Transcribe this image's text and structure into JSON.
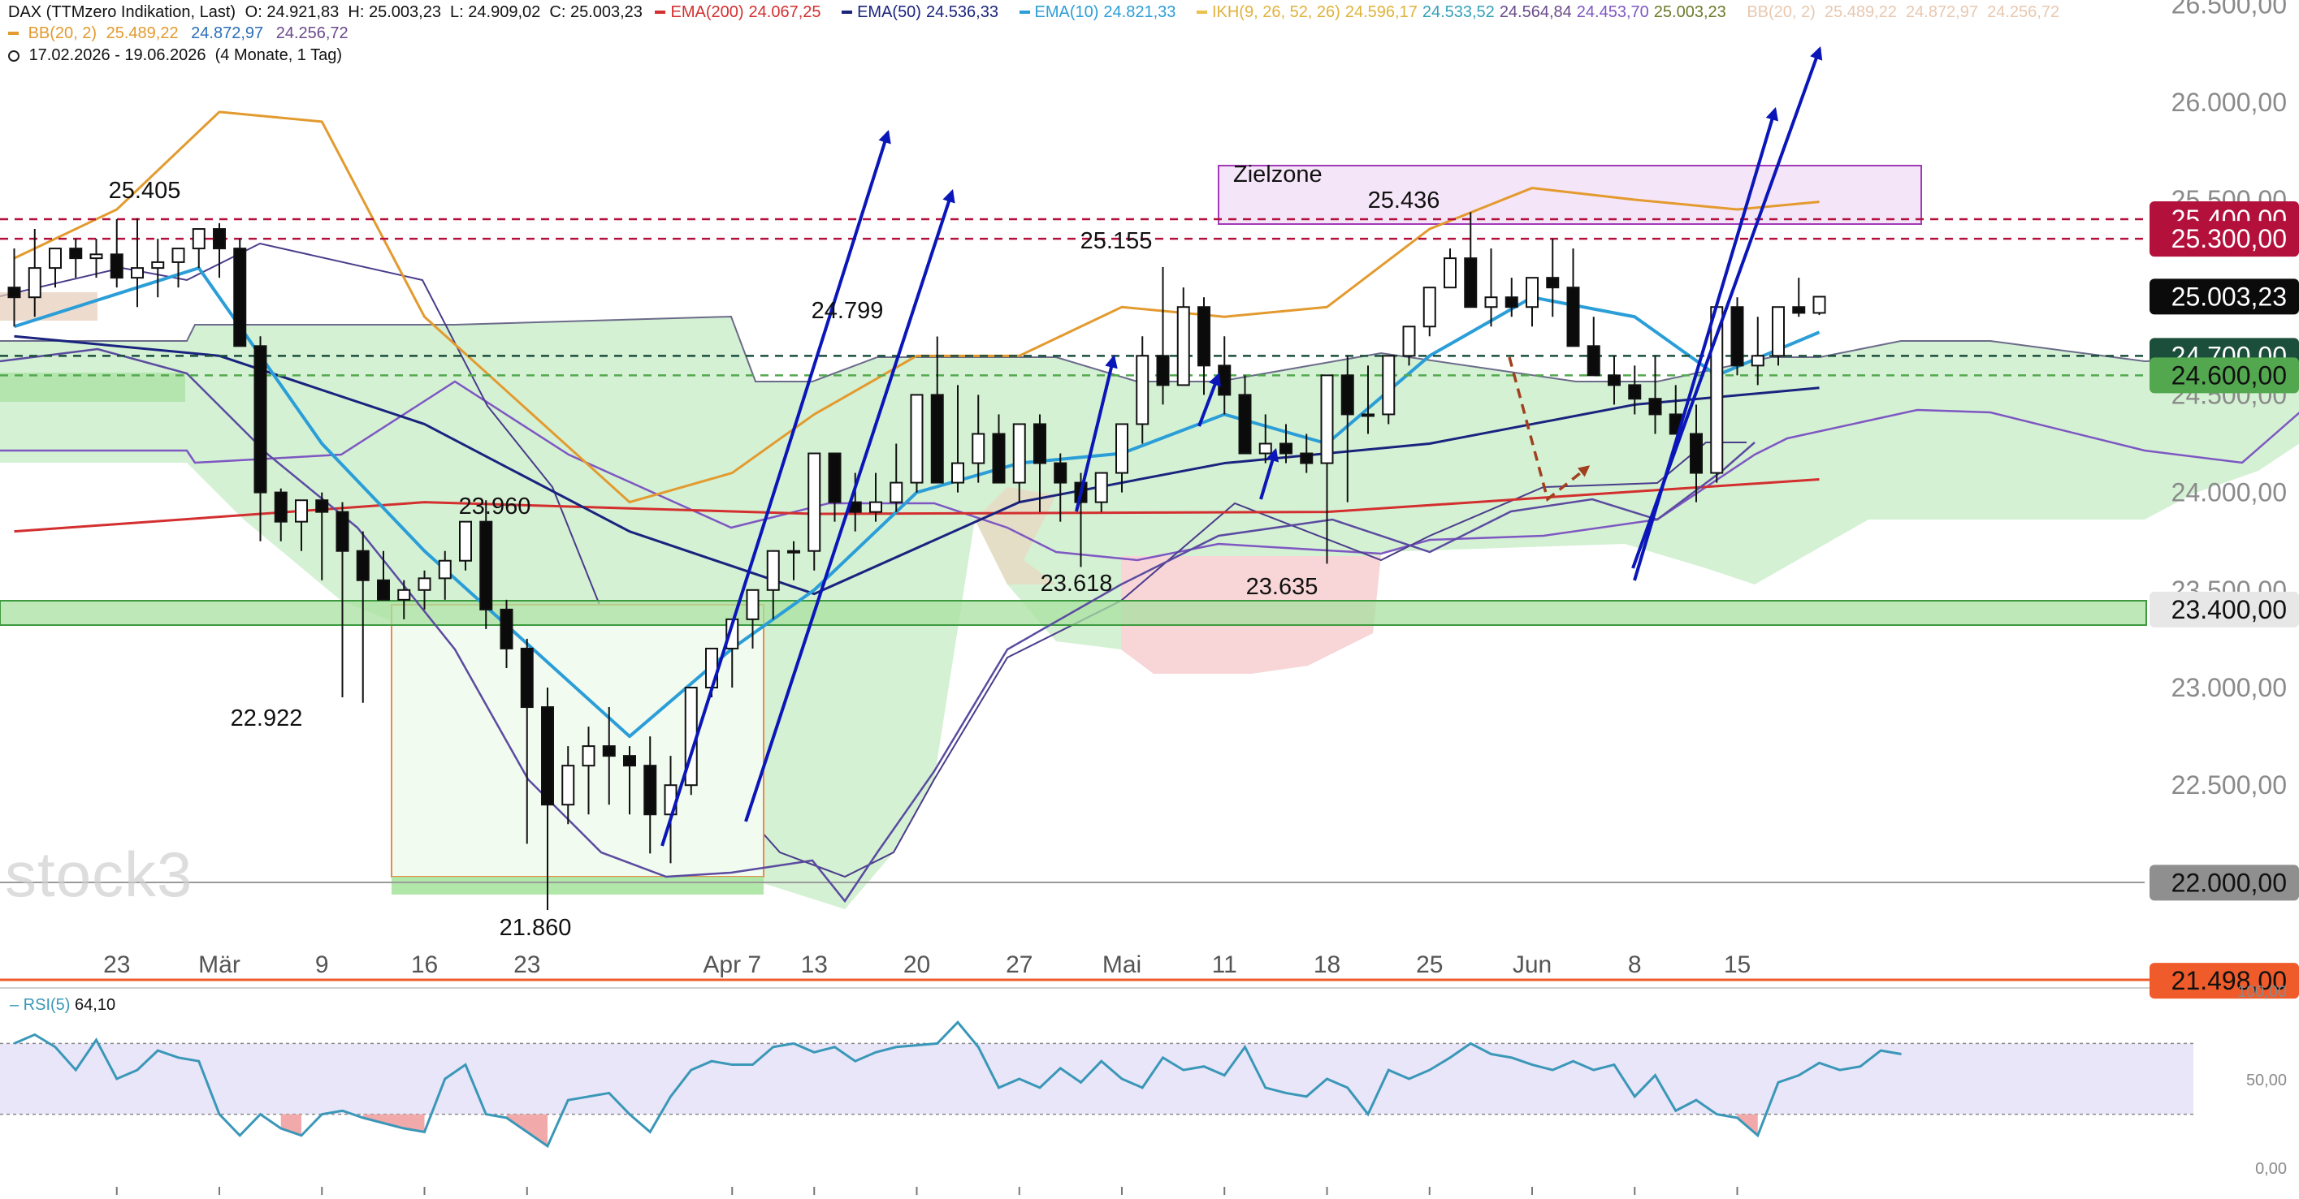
{
  "header": {
    "line1": {
      "title": "DAX (TTMzero Indikation, Last)",
      "ohlc": "O: 24.921,83  H: 25.003,23  L: 24.909,02  C: 25.003,23",
      "ema200_label": "EMA(200)",
      "ema200_value": "24.067,25",
      "ema50_label": "EMA(50)",
      "ema50_value": "24.536,33",
      "ema10_label": "EMA(10)",
      "ema10_value": "24.821,33",
      "ikh_label": "IKH(9, 26, 52, 26)",
      "ikh_v1": "24.596,17",
      "ikh_v2": "24.533,52",
      "ikh_v3": "24.564,84",
      "ikh_v4": "24.453,70",
      "ikh_v5": "25.003,23",
      "bb_faded": "BB(20, 2)  25.489,22  24.872,97  24.256,72"
    },
    "line2": {
      "bb_label": "BB(20, 2)",
      "bb_v1": "25.489,22",
      "bb_v2": "24.872,97",
      "bb_v3": "24.256,72"
    },
    "line3": {
      "range": "17.02.2026 - 19.06.2026  (4 Monate, 1 Tag)"
    }
  },
  "watermark": "stock3",
  "colors": {
    "ema200": "#d32f2f",
    "ema50": "#1a237e",
    "ema10": "#2b9ed8",
    "bb": "#e39a2e",
    "ikh_tenkan": "#e9c14c",
    "senkou_a": "#7e57c2",
    "senkou_b": "#4b3c8a",
    "kumo_up": "#cdeecc",
    "kumo_down": "#f8d6d8",
    "arrow": "#0a16b8",
    "last_price_bg": "#0b0b0b",
    "red_level": "#b3103c",
    "green_level": "#53a84f"
  },
  "chart_data": [
    {
      "type": "candlestick",
      "title": "",
      "x": [
        "16.02",
        "17.02",
        "18.02",
        "19.02",
        "20.02",
        "23.02",
        "24.02",
        "25.02",
        "26.02",
        "27.02",
        "02.03",
        "03.03",
        "04.03",
        "05.03",
        "06.03",
        "09.03",
        "10.03",
        "11.03",
        "12.03",
        "13.03",
        "16.03",
        "17.03",
        "18.03",
        "19.03",
        "20.03",
        "23.03",
        "24.03",
        "25.03",
        "26.03",
        "27.03",
        "30.03",
        "31.03",
        "01.04",
        "02.04",
        "03.04",
        "07.04",
        "08.04",
        "09.04",
        "10.04",
        "13.04",
        "14.04",
        "15.04",
        "16.04",
        "17.04",
        "20.04",
        "21.04",
        "22.04",
        "23.04",
        "24.04",
        "27.04",
        "28.04",
        "29.04",
        "30.04",
        "01.05",
        "04.05",
        "05.05",
        "06.05",
        "07.05",
        "08.05",
        "11.05",
        "12.05",
        "13.05",
        "14.05",
        "15.05",
        "18.05",
        "19.05",
        "20.05",
        "21.05",
        "22.05",
        "25.05",
        "26.05",
        "27.05",
        "28.05",
        "29.05",
        "01.06",
        "02.06",
        "03.06",
        "04.06",
        "05.06",
        "08.06",
        "09.06",
        "10.06",
        "11.06",
        "12.06",
        "15.06",
        "16.06",
        "17.06",
        "18.06",
        "19.06"
      ],
      "open": [
        25050,
        25000,
        25150,
        25250,
        25200,
        25220,
        25100,
        25150,
        25180,
        25250,
        25350,
        25250,
        24750,
        24000,
        23850,
        23960,
        23900,
        23700,
        23550,
        23450,
        23500,
        23560,
        23650,
        23850,
        23400,
        23200,
        22900,
        22400,
        22600,
        22700,
        22650,
        22600,
        22350,
        22500,
        23000,
        23200,
        23350,
        23500,
        23700,
        23700,
        24200,
        23950,
        23900,
        23950,
        24050,
        24500,
        24050,
        24150,
        24300,
        24050,
        24350,
        24150,
        24050,
        23950,
        24100,
        24350,
        24700,
        24550,
        24950,
        24650,
        24500,
        24200,
        24250,
        24200,
        24150,
        24600,
        24400,
        24400,
        24700,
        24850,
        25050,
        25200,
        24950,
        25000,
        24950,
        25100,
        25050,
        24750,
        24600,
        24550,
        24480,
        24400,
        24300,
        24100,
        24950,
        24650,
        24700,
        24950,
        24920
      ],
      "high": [
        25250,
        25350,
        25200,
        25300,
        25300,
        25400,
        25405,
        25300,
        25250,
        25300,
        25380,
        25300,
        24800,
        24020,
        23960,
        24000,
        23950,
        23800,
        23700,
        23550,
        23600,
        23700,
        23850,
        23960,
        23450,
        23250,
        23000,
        22700,
        22800,
        22900,
        22700,
        22750,
        22650,
        22950,
        23200,
        23350,
        23500,
        23600,
        23750,
        23850,
        24200,
        24100,
        24100,
        24250,
        24400,
        24799,
        24550,
        24500,
        24400,
        24300,
        24400,
        24200,
        24100,
        24050,
        24300,
        24800,
        25155,
        25050,
        25000,
        24800,
        24600,
        24400,
        24350,
        24300,
        24300,
        24700,
        24650,
        24700,
        24850,
        25050,
        25250,
        25436,
        25250,
        25100,
        25100,
        25300,
        25250,
        24900,
        24700,
        24650,
        24700,
        24550,
        24450,
        24600,
        25000,
        24900,
        24900,
        25100,
        25003
      ],
      "low": [
        24850,
        24900,
        25050,
        25100,
        25100,
        25050,
        24950,
        25000,
        25050,
        25150,
        25100,
        24800,
        23750,
        23750,
        23700,
        23550,
        22950,
        22922,
        23450,
        23350,
        23400,
        23450,
        23600,
        23300,
        23100,
        22200,
        21860,
        22300,
        22350,
        22400,
        22350,
        22150,
        22100,
        22450,
        22950,
        23000,
        23200,
        23350,
        23550,
        23600,
        23850,
        23800,
        23850,
        23900,
        24000,
        24050,
        24000,
        24050,
        24050,
        23950,
        23900,
        23850,
        23618,
        23900,
        24000,
        24250,
        24450,
        24550,
        24500,
        24400,
        24300,
        24150,
        24150,
        24100,
        23635,
        23950,
        24300,
        24350,
        24650,
        24800,
        25050,
        25000,
        24850,
        24900,
        24850,
        24900,
        24750,
        24600,
        24450,
        24400,
        24300,
        24350,
        23950,
        24050,
        24600,
        24550,
        24650,
        24900,
        24909
      ],
      "close": [
        25000,
        25150,
        25250,
        25200,
        25220,
        25100,
        25150,
        25180,
        25250,
        25350,
        25250,
        24750,
        24000,
        23850,
        23960,
        23900,
        23700,
        23550,
        23450,
        23500,
        23560,
        23650,
        23850,
        23400,
        23200,
        22900,
        22400,
        22600,
        22700,
        22650,
        22600,
        22350,
        22500,
        23000,
        23200,
        23350,
        23500,
        23700,
        23700,
        24200,
        23950,
        23900,
        23950,
        24050,
        24500,
        24050,
        24150,
        24300,
        24050,
        24350,
        24150,
        24050,
        23950,
        24100,
        24350,
        24700,
        24550,
        24950,
        24650,
        24500,
        24200,
        24250,
        24200,
        24150,
        24600,
        24400,
        24400,
        24700,
        24850,
        25050,
        25200,
        24950,
        25000,
        24950,
        25100,
        25050,
        24750,
        24600,
        24550,
        24480,
        24400,
        24300,
        24100,
        24950,
        24650,
        24700,
        24950,
        24920,
        25003
      ],
      "xlabel": "",
      "ylabel": "",
      "ylim": [
        21450,
        26550
      ],
      "price_ticks": [
        "26.500,00",
        "26.000,00",
        "25.500,00",
        "25.000,00",
        "24.500,00",
        "24.000,00",
        "23.500,00",
        "23.000,00",
        "22.500,00",
        "22.000,00"
      ],
      "x_tick_labels": [
        {
          "label": "23",
          "x": "23.02"
        },
        {
          "label": "Mär",
          "x": "02.03"
        },
        {
          "label": "9",
          "x": "09.03"
        },
        {
          "label": "16",
          "x": "16.03"
        },
        {
          "label": "23",
          "x": "23.03"
        },
        {
          "label": "Apr 7",
          "x": "07.04"
        },
        {
          "label": "13",
          "x": "13.04"
        },
        {
          "label": "20",
          "x": "20.04"
        },
        {
          "label": "27",
          "x": "27.04"
        },
        {
          "label": "Mai",
          "x": "04.05"
        },
        {
          "label": "11",
          "x": "11.05"
        },
        {
          "label": "18",
          "x": "18.05"
        },
        {
          "label": "25",
          "x": "25.05"
        },
        {
          "label": "Jun",
          "x": "01.06"
        },
        {
          "label": "8",
          "x": "08.06"
        },
        {
          "label": "15",
          "x": "15.06"
        }
      ],
      "series": [
        {
          "name": "EMA(200)",
          "x": [
            "16.02",
            "16.03",
            "13.04",
            "18.05",
            "19.06"
          ],
          "values": [
            23800,
            23950,
            23890,
            23900,
            24067
          ]
        },
        {
          "name": "EMA(50)",
          "x": [
            "16.02",
            "02.03",
            "16.03",
            "30.03",
            "13.04",
            "27.04",
            "11.05",
            "25.05",
            "08.06",
            "19.06"
          ],
          "values": [
            24800,
            24700,
            24350,
            23800,
            23480,
            23950,
            24150,
            24250,
            24450,
            24536
          ]
        },
        {
          "name": "EMA(10)",
          "x": [
            "16.02",
            "27.02",
            "09.03",
            "16.03",
            "30.03",
            "07.04",
            "13.04",
            "20.04",
            "27.04",
            "04.05",
            "11.05",
            "18.05",
            "25.05",
            "01.06",
            "08.06",
            "12.06",
            "19.06"
          ],
          "values": [
            24850,
            25150,
            24250,
            23700,
            22750,
            23200,
            23500,
            24000,
            24150,
            24200,
            24400,
            24250,
            24700,
            25000,
            24900,
            24600,
            24821
          ]
        },
        {
          "name": "BB(20, 2)",
          "x": [
            "16.02",
            "23.02",
            "02.03",
            "09.03",
            "16.03",
            "30.03",
            "07.04",
            "13.04",
            "20.04",
            "27.04",
            "04.05",
            "11.05",
            "18.05",
            "25.05",
            "01.06",
            "08.06",
            "15.06",
            "19.06"
          ],
          "values": [
            25200,
            25450,
            25950,
            25900,
            24900,
            23950,
            24100,
            24400,
            24700,
            24700,
            24950,
            24900,
            24950,
            25350,
            25560,
            25500,
            25450,
            25489
          ]
        }
      ],
      "levels": [
        {
          "value": "25.400,00",
          "label_color": "#b3103c",
          "style": "dashed"
        },
        {
          "value": "25.300,00",
          "label_color": "#b3103c",
          "style": "dashed"
        },
        {
          "value": "25.003,23",
          "label_color": "#0b0b0b",
          "style": "last"
        },
        {
          "value": "24.700,00",
          "label_color": "#1b4e3b",
          "style": "dashed"
        },
        {
          "value": "24.600,00",
          "label_color": "#53a84f",
          "style": "dashed"
        },
        {
          "value": "23.400,00",
          "label_color": "#e7e7e7",
          "style": "band"
        },
        {
          "value": "22.000,00",
          "label_color": "#8f8f8f",
          "style": "solid"
        },
        {
          "value": "21.498,00",
          "label_color": "#ef5b2a",
          "style": "solid"
        }
      ],
      "annotations": [
        "25.405",
        "24.799",
        "25.155",
        "25.436",
        "23.960",
        "22.922",
        "21.860",
        "23.618",
        "23.635",
        "Zielzone"
      ]
    },
    {
      "type": "line",
      "title": "",
      "series": [
        {
          "name": "RSI(5)",
          "last": "64,10",
          "values": [
            70,
            75,
            68,
            55,
            72,
            50,
            55,
            66,
            62,
            60,
            30,
            18,
            30,
            22,
            18,
            30,
            32,
            28,
            25,
            22,
            20,
            50,
            58,
            30,
            28,
            20,
            12,
            38,
            40,
            42,
            30,
            20,
            40,
            55,
            60,
            58,
            58,
            68,
            70,
            65,
            68,
            60,
            65,
            68,
            69,
            70,
            82,
            68,
            45,
            50,
            45,
            56,
            48,
            60,
            50,
            45,
            62,
            55,
            57,
            52,
            68,
            45,
            42,
            40,
            50,
            45,
            30,
            55,
            50,
            55,
            62,
            70,
            64,
            62,
            58,
            55,
            60,
            55,
            58,
            40,
            52,
            32,
            38,
            30,
            28,
            18,
            48,
            52,
            59,
            55,
            57,
            66,
            64
          ]
        }
      ],
      "ylim": [
        0,
        100
      ],
      "tick_labels": [
        "100,00",
        "50,00",
        "0,00"
      ],
      "overbought": 70,
      "oversold": 30
    }
  ]
}
